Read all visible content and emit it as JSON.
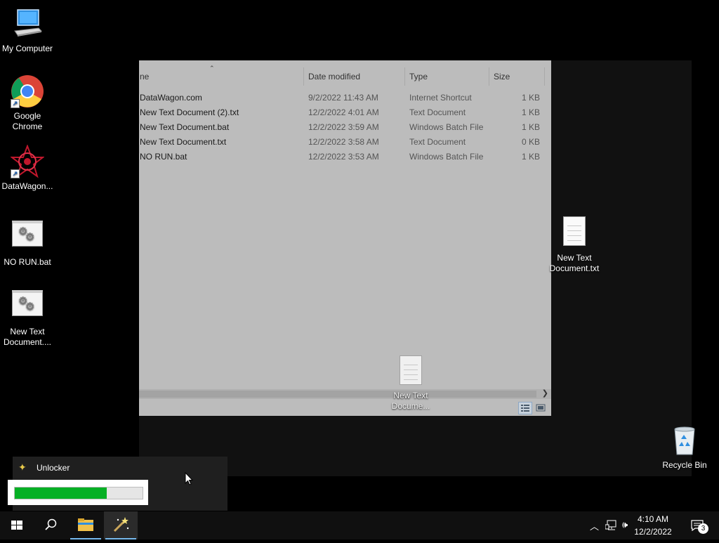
{
  "desktop": {
    "icons": [
      {
        "label": "My Computer"
      },
      {
        "label": "Google Chrome"
      },
      {
        "label": "DataWagon..."
      },
      {
        "label": "NO RUN.bat"
      },
      {
        "label": "New Text Document...."
      },
      {
        "label": "New Text Document.txt"
      },
      {
        "label": "Recycle Bin"
      }
    ],
    "dragged_icon": {
      "label": "New Text Docume..."
    }
  },
  "explorer": {
    "columns": {
      "name": "ne",
      "date": "Date modified",
      "type": "Type",
      "size": "Size"
    },
    "rows": [
      {
        "name": "DataWagon.com",
        "date": "9/2/2022 11:43 AM",
        "type": "Internet Shortcut",
        "size": "1 KB"
      },
      {
        "name": "New Text Document (2).txt",
        "date": "12/2/2022 4:01 AM",
        "type": "Text Document",
        "size": "1 KB"
      },
      {
        "name": "New Text Document.bat",
        "date": "12/2/2022 3:59 AM",
        "type": "Windows Batch File",
        "size": "1 KB"
      },
      {
        "name": "New Text Document.txt",
        "date": "12/2/2022 3:58 AM",
        "type": "Text Document",
        "size": "0 KB"
      },
      {
        "name": "NO RUN.bat",
        "date": "12/2/2022 3:53 AM",
        "type": "Windows Batch File",
        "size": "1 KB"
      }
    ]
  },
  "unlocker": {
    "title": "Unlocker",
    "progress": 0.72
  },
  "taskbar": {
    "time": "4:10 AM",
    "date": "12/2/2022",
    "notifications": "3"
  },
  "colors": {
    "progress_fill": "#06b025",
    "taskbar_accent": "#76b9ed"
  }
}
